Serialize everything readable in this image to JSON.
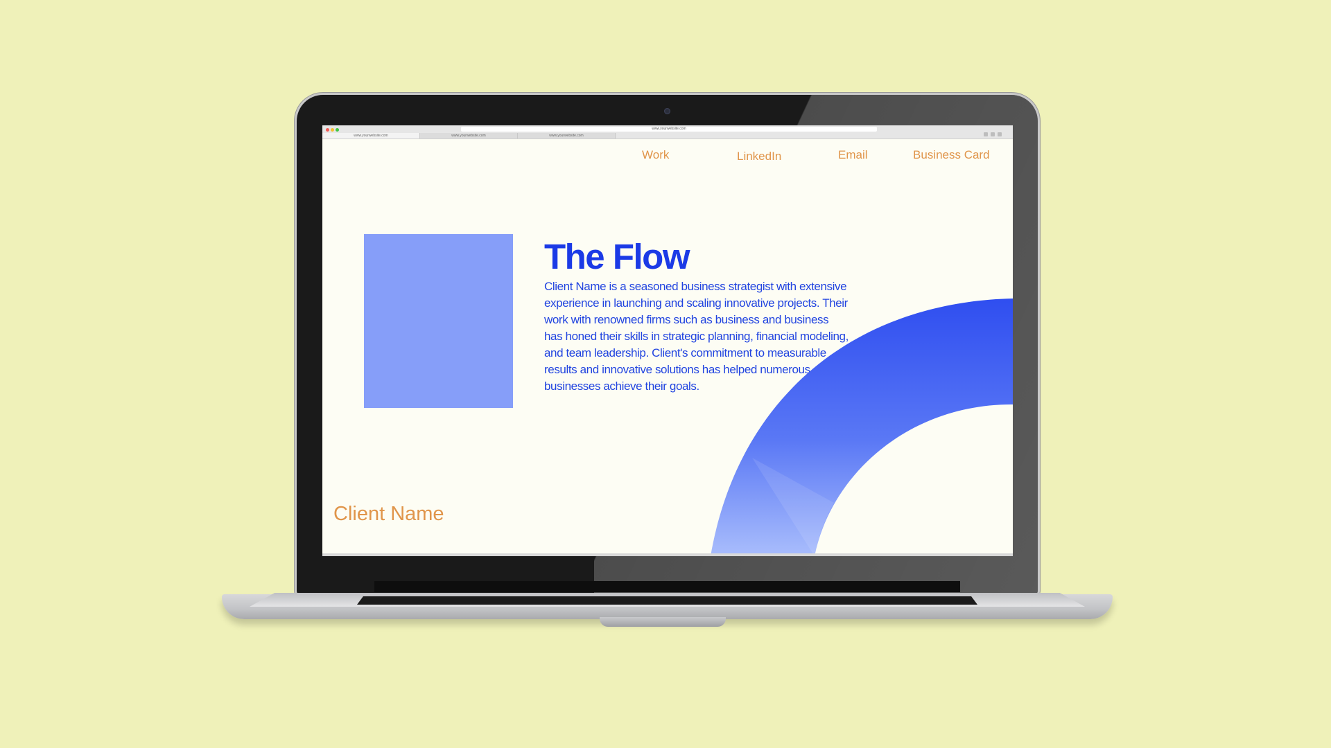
{
  "browser": {
    "url": "www.yourwebsite.com",
    "tabs": [
      "www.yourwebsite.com",
      "www.yourwebsite.com",
      "www.yourwebsite.com"
    ]
  },
  "nav": {
    "items": [
      {
        "label": "Work"
      },
      {
        "label": "LinkedIn"
      },
      {
        "label": "Email"
      },
      {
        "label": "Business Card"
      }
    ]
  },
  "hero": {
    "title": "The Flow",
    "body": "Client Name is a seasoned business strategist with extensive experience in launching and scaling innovative projects. Their work with renowned firms such as business and business has honed their skills in strategic planning, financial modeling, and team leadership. Client's commitment to measurable results and innovative solutions has helped numerous businesses achieve their goals."
  },
  "footer": {
    "client_name": "Client Name"
  },
  "colors": {
    "background": "#eff1b9",
    "page": "#fdfdf4",
    "accent_blue": "#1b3ae6",
    "block_blue": "#869ef9",
    "orange": "#e0954a"
  }
}
